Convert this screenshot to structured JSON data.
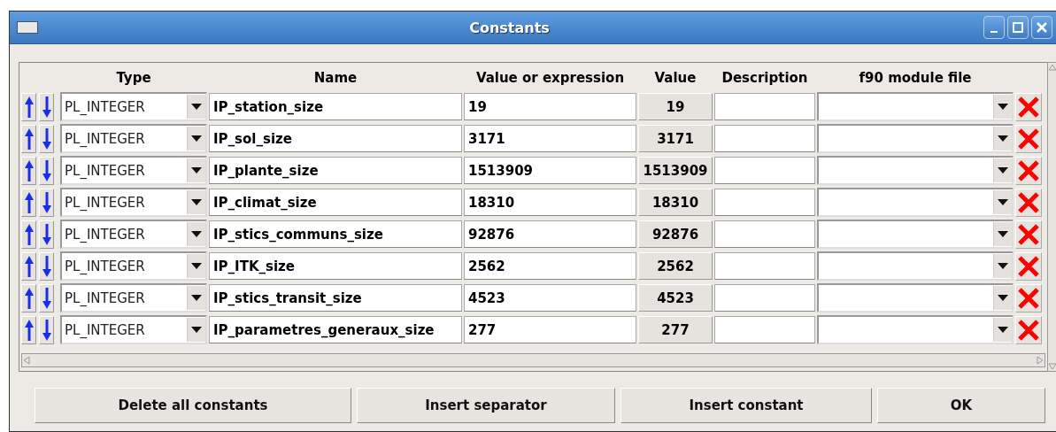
{
  "window": {
    "title": "Constants"
  },
  "table": {
    "columns": [
      "Type",
      "Name",
      "Value or expression",
      "Value",
      "Description",
      "f90 module file"
    ],
    "rows": [
      {
        "type": "PL_INTEGER",
        "name": "IP_station_size",
        "expression": "19",
        "value": "19"
      },
      {
        "type": "PL_INTEGER",
        "name": "IP_sol_size",
        "expression": "3171",
        "value": "3171"
      },
      {
        "type": "PL_INTEGER",
        "name": "IP_plante_size",
        "expression": "1513909",
        "value": "1513909"
      },
      {
        "type": "PL_INTEGER",
        "name": "IP_climat_size",
        "expression": "18310",
        "value": "18310"
      },
      {
        "type": "PL_INTEGER",
        "name": "IP_stics_communs_size",
        "expression": "92876",
        "value": "92876"
      },
      {
        "type": "PL_INTEGER",
        "name": "IP_ITK_size",
        "expression": "2562",
        "value": "2562"
      },
      {
        "type": "PL_INTEGER",
        "name": "IP_stics_transit_size",
        "expression": "4523",
        "value": "4523"
      },
      {
        "type": "PL_INTEGER",
        "name": "IP_parametres_generaux_size",
        "expression": "277",
        "value": "277"
      }
    ]
  },
  "buttons": [
    "Delete all constants",
    "Insert separator",
    "Insert constant",
    "OK"
  ]
}
